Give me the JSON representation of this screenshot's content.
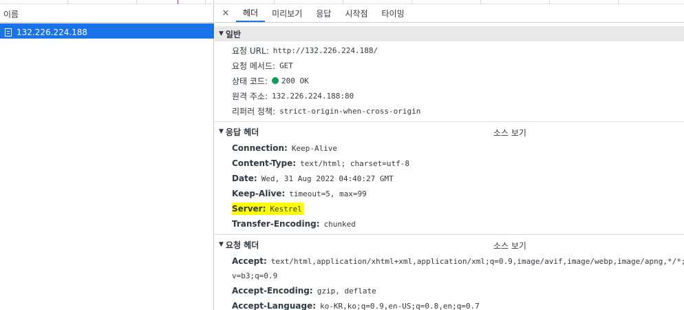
{
  "left_panel": {
    "column_header": "이름",
    "selected_request": "132.226.224.188"
  },
  "tabs": [
    {
      "label": "헤더"
    },
    {
      "label": "미리보기"
    },
    {
      "label": "응답"
    },
    {
      "label": "시작점"
    },
    {
      "label": "타이밍"
    }
  ],
  "general": {
    "title": "일반",
    "rows": [
      {
        "key": "요청 URL:",
        "value": "http://132.226.224.188/"
      },
      {
        "key": "요청 메서드:",
        "value": "GET"
      },
      {
        "key": "상태 코드:",
        "value": "200 OK",
        "status_color": "#0f9d58"
      },
      {
        "key": "원격 주소:",
        "value": "132.226.224.188:80"
      },
      {
        "key": "리퍼러 정책:",
        "value": "strict-origin-when-cross-origin"
      }
    ]
  },
  "response_headers": {
    "title": "응답 헤더",
    "view_source": "소스 보기",
    "rows": [
      {
        "key": "Connection:",
        "value": "Keep-Alive"
      },
      {
        "key": "Content-Type:",
        "value": "text/html; charset=utf-8"
      },
      {
        "key": "Date:",
        "value": "Wed, 31 Aug 2022 04:40:27 GMT"
      },
      {
        "key": "Keep-Alive:",
        "value": "timeout=5, max=99"
      },
      {
        "key": "Server:",
        "value": "Kestrel",
        "highlight": "#ffff00"
      },
      {
        "key": "Transfer-Encoding:",
        "value": "chunked"
      }
    ]
  },
  "request_headers": {
    "title": "요청 헤더",
    "view_source": "소스 보기",
    "rows": [
      {
        "key": "Accept:",
        "value": "text/html,application/xhtml+xml,application/xml;q=0.9,image/avif,image/webp,image/apng,*/*;q=",
        "continuation": "v=b3;q=0.9"
      },
      {
        "key": "Accept-Encoding:",
        "value": "gzip, deflate"
      },
      {
        "key": "Accept-Language:",
        "value": "ko-KR,ko;q=0.9,en-US;q=0.8,en;q=0.7"
      }
    ]
  },
  "icons": {
    "request": "document-icon",
    "close": "close-icon",
    "expand": "triangle-down-icon",
    "status": "status-dot-icon"
  },
  "colors": {
    "selection": "#1a73e8",
    "status_ok": "#0f9d58",
    "highlight": "#ffff00"
  }
}
